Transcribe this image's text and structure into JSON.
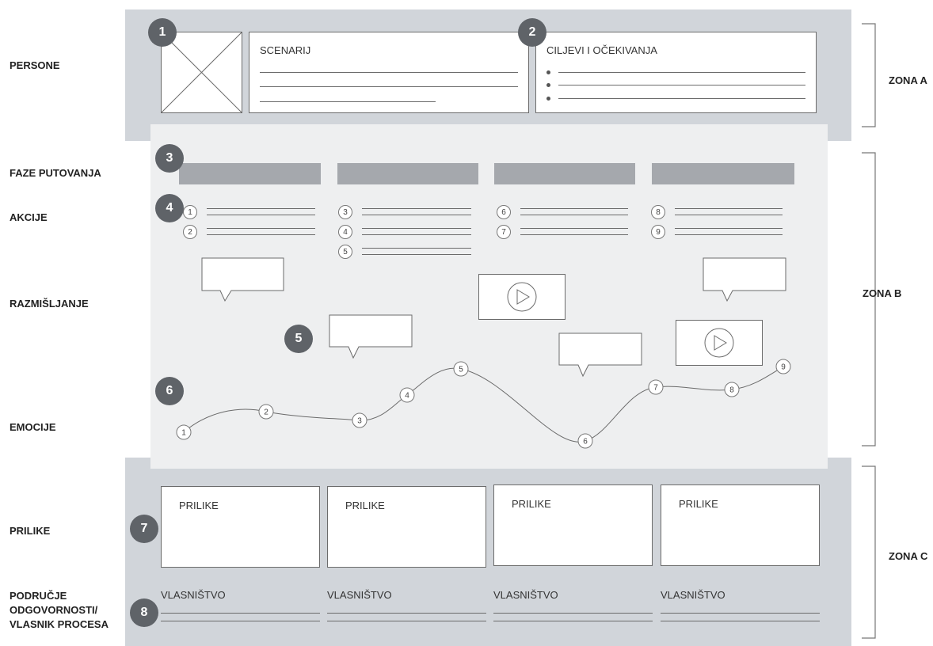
{
  "row_labels": {
    "persone": "PERSONE",
    "faze": "FAZE PUTOVANJA",
    "akcije": "AKCIJE",
    "razmisljanje": "RAZMIŠLJANJE",
    "emocije": "EMOCIJE",
    "prilike": "PRILIKE",
    "podrucje": [
      "PODRUČJE",
      "ODGOVORNOSTI/",
      "VLASNIK PROCESA"
    ]
  },
  "zones": [
    "ZONA A",
    "ZONA B",
    "ZONA C"
  ],
  "badges": [
    "1",
    "2",
    "3",
    "4",
    "5",
    "6",
    "7",
    "8"
  ],
  "persona": {
    "scenario_title": "SCENARIJ",
    "goals_title": "CILJEVI I OČEKIVANJA"
  },
  "actions": [
    [
      "1",
      "2"
    ],
    [
      "3",
      "4",
      "5"
    ],
    [
      "6",
      "7"
    ],
    [
      "8",
      "9"
    ]
  ],
  "emotions": [
    "1",
    "2",
    "3",
    "4",
    "5",
    "6",
    "7",
    "8",
    "9"
  ],
  "opportunities": [
    "PRILIKE",
    "PRILIKE",
    "PRILIKE",
    "PRILIKE"
  ],
  "ownership": [
    "VLASNIŠTVO",
    "VLASNIŠTVO",
    "VLASNIŠTVO",
    "VLASNIŠTVO"
  ],
  "colors": {
    "zone_bg": "#d1d5da",
    "zone_b_bg": "#eeeff0",
    "phase_bar": "#a5a8ad",
    "badge": "#5f6368"
  },
  "icons": [
    "image-placeholder-icon",
    "speech-bubble-icon",
    "video-play-icon"
  ]
}
